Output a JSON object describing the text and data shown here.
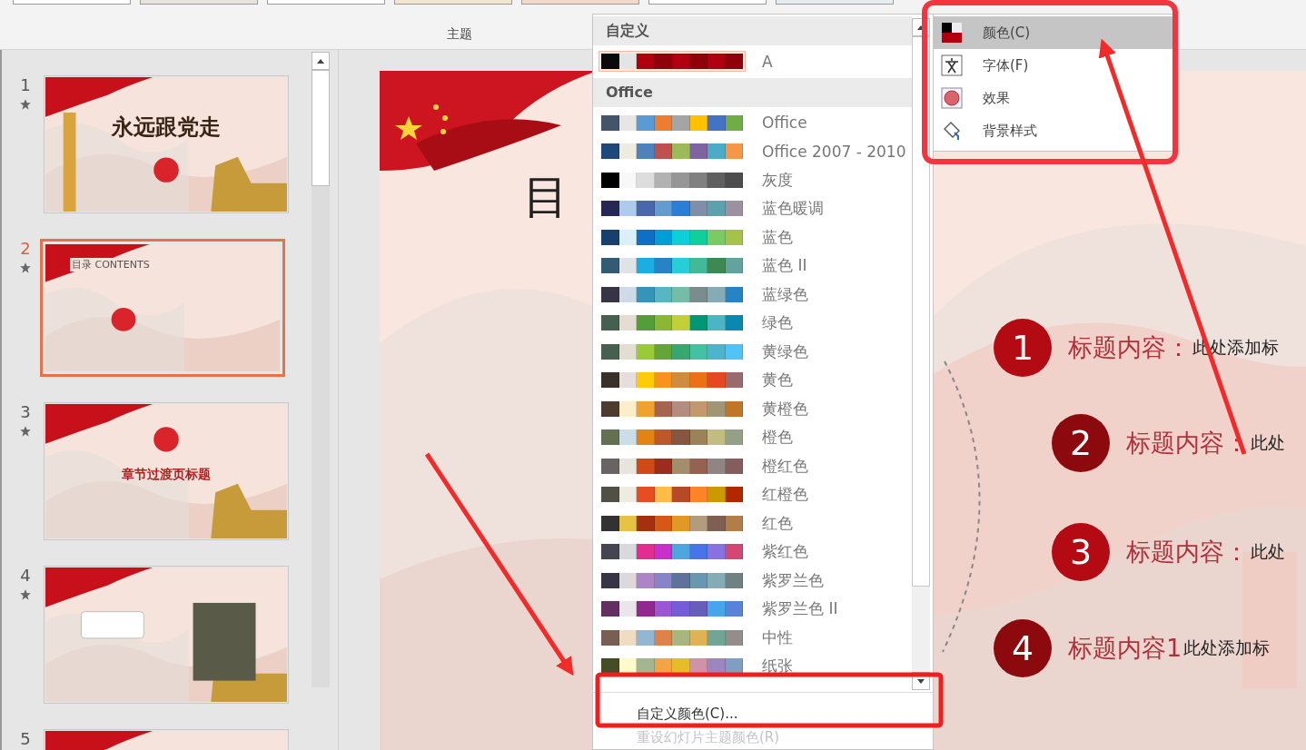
{
  "ribbon": {
    "group_label": "主题"
  },
  "slides": [
    {
      "number": "1",
      "selected": false,
      "star": true,
      "title": "永远跟党走"
    },
    {
      "number": "2",
      "selected": true,
      "star": true,
      "title": "目录 CONTENTS"
    },
    {
      "number": "3",
      "selected": false,
      "star": true,
      "title": "章节过渡页标题"
    },
    {
      "number": "4",
      "selected": false,
      "star": true
    },
    {
      "number": "5",
      "selected": false
    }
  ],
  "slide": {
    "title": "目",
    "items": [
      {
        "number": "1",
        "title": "标题内容：",
        "text": "此处添加标"
      },
      {
        "number": "2",
        "title": "标题内容：",
        "text": "此处"
      },
      {
        "number": "3",
        "title": "标题内容：",
        "text": "此处"
      },
      {
        "number": "4",
        "title": "标题内容1",
        "text": "此处添加标"
      }
    ]
  },
  "colors_menu": {
    "sections": [
      {
        "header": "自定义",
        "palettes": [
          {
            "name": "A",
            "selected": true,
            "swatches": [
              {
                "color": "#0a0a0a"
              },
              {
                "color": "#e4e4e4"
              },
              {
                "color": "#b00010"
              },
              {
                "color": "#900008"
              },
              {
                "color": "#b00010"
              },
              {
                "color": "#900008"
              },
              {
                "color": "#b00010"
              },
              {
                "color": "#900008"
              }
            ]
          }
        ]
      },
      {
        "header": "Office",
        "palettes": [
          {
            "name": "Office",
            "selected": false,
            "swatches": [
              {
                "color": "#44546a"
              },
              {
                "color": "#e7e6e6"
              },
              {
                "color": "#5b9bd5"
              },
              {
                "color": "#ed7d31"
              },
              {
                "color": "#a5a5a5"
              },
              {
                "color": "#ffc000"
              },
              {
                "color": "#4472c4"
              },
              {
                "color": "#70ad47"
              }
            ]
          },
          {
            "name": "Office 2007 - 2010",
            "selected": false,
            "swatches": [
              {
                "color": "#1f497d"
              },
              {
                "color": "#eeece1"
              },
              {
                "color": "#4f81bd"
              },
              {
                "color": "#c0504d"
              },
              {
                "color": "#9bbb59"
              },
              {
                "color": "#8064a2"
              },
              {
                "color": "#4bacc6"
              },
              {
                "color": "#f79646"
              }
            ]
          },
          {
            "name": "灰度",
            "selected": false,
            "swatches": [
              {
                "color": "#000000"
              },
              {
                "color": "#f8f8f8"
              },
              {
                "color": "#dddddd"
              },
              {
                "color": "#b2b2b2"
              },
              {
                "color": "#969696"
              },
              {
                "color": "#808080"
              },
              {
                "color": "#5f5f5f"
              },
              {
                "color": "#4d4d4d"
              }
            ]
          },
          {
            "name": "蓝色暖调",
            "selected": false,
            "swatches": [
              {
                "color": "#242852"
              },
              {
                "color": "#acccea"
              },
              {
                "color": "#4a66ac"
              },
              {
                "color": "#629dd1"
              },
              {
                "color": "#297fd5"
              },
              {
                "color": "#7f8fa9"
              },
              {
                "color": "#5aa2ae"
              },
              {
                "color": "#9d90a0"
              }
            ]
          },
          {
            "name": "蓝色",
            "selected": false,
            "swatches": [
              {
                "color": "#17406d"
              },
              {
                "color": "#dbeff9"
              },
              {
                "color": "#0f6fc6"
              },
              {
                "color": "#009dd9"
              },
              {
                "color": "#0bd0d9"
              },
              {
                "color": "#10cf9b"
              },
              {
                "color": "#7cca62"
              },
              {
                "color": "#a5c249"
              }
            ]
          },
          {
            "name": "蓝色 II",
            "selected": false,
            "swatches": [
              {
                "color": "#335b74"
              },
              {
                "color": "#dfe3e5"
              },
              {
                "color": "#1cade4"
              },
              {
                "color": "#2683c6"
              },
              {
                "color": "#27ced7"
              },
              {
                "color": "#42ba97"
              },
              {
                "color": "#3e8853"
              },
              {
                "color": "#62a39f"
              }
            ]
          },
          {
            "name": "蓝绿色",
            "selected": false,
            "swatches": [
              {
                "color": "#373545"
              },
              {
                "color": "#cedbe6"
              },
              {
                "color": "#3494ba"
              },
              {
                "color": "#58b6c0"
              },
              {
                "color": "#75bda7"
              },
              {
                "color": "#7a8c8e"
              },
              {
                "color": "#84acb6"
              },
              {
                "color": "#2683c6"
              }
            ]
          },
          {
            "name": "绿色",
            "selected": false,
            "swatches": [
              {
                "color": "#455f51"
              },
              {
                "color": "#e3ded1"
              },
              {
                "color": "#549e39"
              },
              {
                "color": "#8ab833"
              },
              {
                "color": "#c0cf3a"
              },
              {
                "color": "#029676"
              },
              {
                "color": "#4ab5c4"
              },
              {
                "color": "#0989b1"
              }
            ]
          },
          {
            "name": "黄绿色",
            "selected": false,
            "swatches": [
              {
                "color": "#455f51"
              },
              {
                "color": "#e3ded1"
              },
              {
                "color": "#99cb38"
              },
              {
                "color": "#63a537"
              },
              {
                "color": "#37a76f"
              },
              {
                "color": "#44c1a3"
              },
              {
                "color": "#4eb3cf"
              },
              {
                "color": "#51c3f9"
              }
            ]
          },
          {
            "name": "黄色",
            "selected": false,
            "swatches": [
              {
                "color": "#39302a"
              },
              {
                "color": "#e5dedb"
              },
              {
                "color": "#ffca08"
              },
              {
                "color": "#f8931d"
              },
              {
                "color": "#ce8d3e"
              },
              {
                "color": "#ec7016"
              },
              {
                "color": "#e64823"
              },
              {
                "color": "#9c6a6a"
              }
            ]
          },
          {
            "name": "黄橙色",
            "selected": false,
            "swatches": [
              {
                "color": "#4e3b30"
              },
              {
                "color": "#fbeec9"
              },
              {
                "color": "#f0a22e"
              },
              {
                "color": "#a5644e"
              },
              {
                "color": "#b58b80"
              },
              {
                "color": "#c3986d"
              },
              {
                "color": "#a19574"
              },
              {
                "color": "#c17529"
              }
            ]
          },
          {
            "name": "橙色",
            "selected": false,
            "swatches": [
              {
                "color": "#637052"
              },
              {
                "color": "#ccddea"
              },
              {
                "color": "#e48312"
              },
              {
                "color": "#bd582c"
              },
              {
                "color": "#865640"
              },
              {
                "color": "#9b8357"
              },
              {
                "color": "#c2bc80"
              },
              {
                "color": "#94a088"
              }
            ]
          },
          {
            "name": "橙红色",
            "selected": false,
            "swatches": [
              {
                "color": "#696464"
              },
              {
                "color": "#e9e5dc"
              },
              {
                "color": "#d34817"
              },
              {
                "color": "#9b2d1f"
              },
              {
                "color": "#a28e6a"
              },
              {
                "color": "#956251"
              },
              {
                "color": "#918485"
              },
              {
                "color": "#855d5d"
              }
            ]
          },
          {
            "name": "红橙色",
            "selected": false,
            "swatches": [
              {
                "color": "#505046"
              },
              {
                "color": "#eeece1"
              },
              {
                "color": "#e84c22"
              },
              {
                "color": "#ffbd47"
              },
              {
                "color": "#b64926"
              },
              {
                "color": "#ff8427"
              },
              {
                "color": "#cc9900"
              },
              {
                "color": "#b22600"
              }
            ]
          },
          {
            "name": "红色",
            "selected": false,
            "swatches": [
              {
                "color": "#323232"
              },
              {
                "color": "#e5c243"
              },
              {
                "color": "#a5300f"
              },
              {
                "color": "#d55816"
              },
              {
                "color": "#e19825"
              },
              {
                "color": "#b19c7d"
              },
              {
                "color": "#7f5f52"
              },
              {
                "color": "#b27d49"
              }
            ]
          },
          {
            "name": "紫红色",
            "selected": false,
            "swatches": [
              {
                "color": "#454551"
              },
              {
                "color": "#d8d9dc"
              },
              {
                "color": "#e32d91"
              },
              {
                "color": "#c830cc"
              },
              {
                "color": "#4ea6dc"
              },
              {
                "color": "#4775e7"
              },
              {
                "color": "#8971e1"
              },
              {
                "color": "#d54773"
              }
            ]
          },
          {
            "name": "紫罗兰色",
            "selected": false,
            "swatches": [
              {
                "color": "#373545"
              },
              {
                "color": "#dcd8dc"
              },
              {
                "color": "#ad84c6"
              },
              {
                "color": "#8784c7"
              },
              {
                "color": "#5d739a"
              },
              {
                "color": "#6997af"
              },
              {
                "color": "#84acb6"
              },
              {
                "color": "#6f8183"
              }
            ]
          },
          {
            "name": "紫罗兰色 II",
            "selected": false,
            "swatches": [
              {
                "color": "#632e62"
              },
              {
                "color": "#eae5eb"
              },
              {
                "color": "#92278f"
              },
              {
                "color": "#9b57d3"
              },
              {
                "color": "#755dd9"
              },
              {
                "color": "#665eb8"
              },
              {
                "color": "#45a5ed"
              },
              {
                "color": "#5982db"
              }
            ]
          },
          {
            "name": "中性",
            "selected": false,
            "swatches": [
              {
                "color": "#7a5e53"
              },
              {
                "color": "#eeddc1"
              },
              {
                "color": "#93b6d2"
              },
              {
                "color": "#e0814a"
              },
              {
                "color": "#a8b57f"
              },
              {
                "color": "#dfb256"
              },
              {
                "color": "#71a596"
              },
              {
                "color": "#968c8c"
              }
            ]
          },
          {
            "name": "纸张",
            "selected": false,
            "swatches": [
              {
                "color": "#444d26"
              },
              {
                "color": "#fefac9"
              },
              {
                "color": "#a5b592"
              },
              {
                "color": "#f3a447"
              },
              {
                "color": "#e7bc29"
              },
              {
                "color": "#d092a7"
              },
              {
                "color": "#9c85c0"
              },
              {
                "color": "#809ec2"
              }
            ]
          }
        ]
      }
    ],
    "commands": [
      {
        "label": "自定义颜色(C)...",
        "disabled": false
      },
      {
        "label": "重设幻灯片主题颜色(R)",
        "disabled": true
      }
    ]
  },
  "variants_menu": {
    "items": [
      {
        "kind": "colors",
        "label": "颜色(C)",
        "selected": true
      },
      {
        "kind": "fonts",
        "label": "字体(F)",
        "selected": false
      },
      {
        "kind": "effects",
        "label": "效果",
        "selected": false
      },
      {
        "kind": "background",
        "label": "背景样式",
        "selected": false
      }
    ]
  }
}
